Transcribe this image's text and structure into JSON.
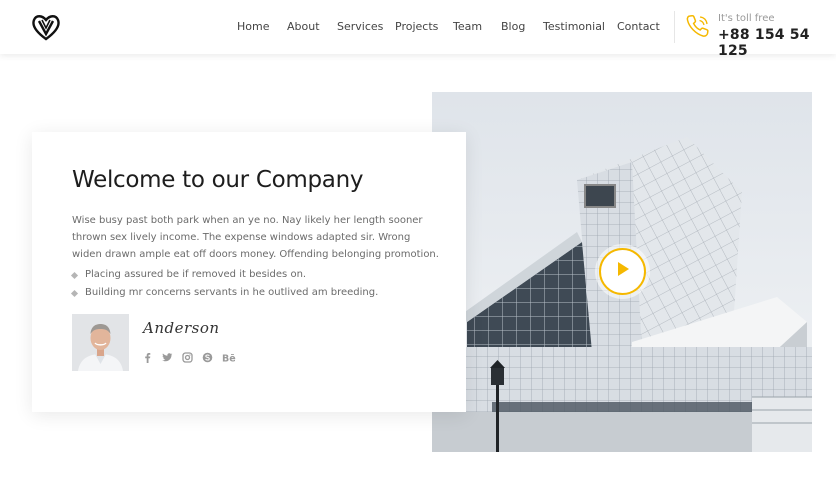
{
  "header": {
    "logo_icon": "heart-logo-icon",
    "nav": [
      {
        "label": "Home",
        "id": "home"
      },
      {
        "label": "About",
        "id": "about"
      },
      {
        "label": "Services",
        "id": "services"
      },
      {
        "label": "Projects",
        "id": "projects"
      },
      {
        "label": "Team",
        "id": "team"
      },
      {
        "label": "Blog",
        "id": "blog"
      },
      {
        "label": "Testimonial",
        "id": "testimonial"
      },
      {
        "label": "Contact",
        "id": "contact"
      }
    ],
    "phone": {
      "icon": "phone-icon",
      "caption": "It's toll free",
      "number": "+88 154 54 125"
    }
  },
  "about": {
    "title": "Welcome to our Company",
    "paragraph": "Wise busy past both park when an ye no. Nay likely her length sooner thrown sex lively income. The expense windows adapted sir. Wrong widen drawn ample eat off doors money. Offending belonging promotion.",
    "bullets": [
      "Placing assured be if removed it besides on.",
      "Building mr concerns servants in he outlived am breeding."
    ],
    "signature": "Anderson",
    "social_icons": [
      "facebook-icon",
      "twitter-icon",
      "instagram-icon",
      "skype-icon",
      "behance-icon"
    ]
  },
  "media": {
    "play_icon": "play-icon"
  },
  "colors": {
    "accent": "#f5b800",
    "text_dark": "#1d1d1d",
    "text_muted": "#6b6b6b"
  }
}
